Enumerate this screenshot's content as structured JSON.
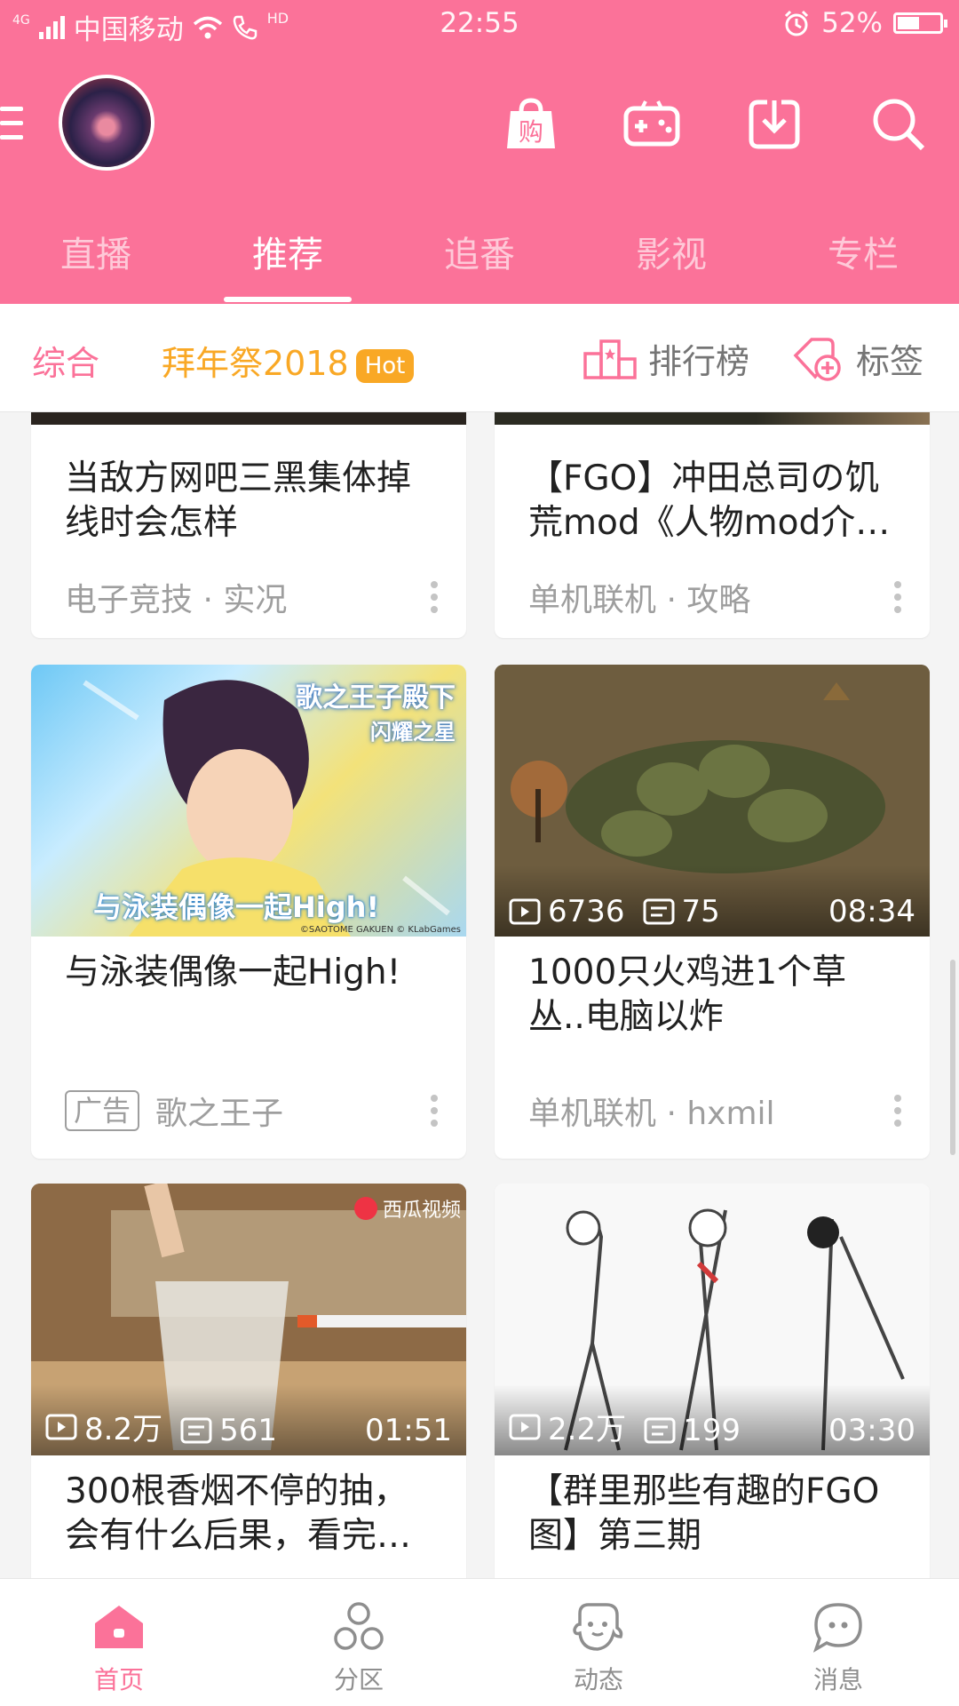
{
  "status": {
    "carrier": "中国移动",
    "network": "4G",
    "hd": "HD",
    "time": "22:55",
    "battery": "52%",
    "battery_level": 0.52
  },
  "header": {
    "tabs": [
      {
        "label": "直播"
      },
      {
        "label": "推荐"
      },
      {
        "label": "追番"
      },
      {
        "label": "影视"
      },
      {
        "label": "专栏"
      }
    ],
    "active_tab": "推荐",
    "icons": [
      "shop-icon",
      "game-icon",
      "download-icon",
      "search-icon"
    ],
    "shop_glyph": "购"
  },
  "subbar": {
    "overview": "综合",
    "event": "拜年祭2018",
    "hot_badge": "Hot",
    "ranking": "排行榜",
    "tags": "标签"
  },
  "cards": [
    {
      "title": "当敌方网吧三黑集体掉线时会怎样",
      "meta": "电子竞技 · 实况"
    },
    {
      "title": "【FGO】冲田总司の饥荒mod《人物mod介…",
      "meta": "单机联机 · 攻略"
    },
    {
      "title": "与泳装偶像一起High!",
      "ad_label": "广告",
      "meta": "歌之王子",
      "banner_text": "歌之王子殿下",
      "banner_sub": "闪耀之星",
      "overlay_text": "与泳装偶像一起High!",
      "copyright": "©SAOTOME GAKUEN © KLabGames"
    },
    {
      "title": "1000只火鸡进1个草丛..电脑以炸",
      "meta": "单机联机 · hxmil",
      "views": "6736",
      "danmaku": "75",
      "duration": "08:34"
    },
    {
      "title": "300根香烟不停的抽，会有什么后果，看完…",
      "views": "8.2万",
      "danmaku": "561",
      "duration": "01:51",
      "watermark": "西瓜视频"
    },
    {
      "title": "【群里那些有趣的FGO图】第三期",
      "views": "2.2万",
      "danmaku": "199",
      "duration": "03:30"
    }
  ],
  "bottom_nav": [
    {
      "label": "首页",
      "icon": "home-icon"
    },
    {
      "label": "分区",
      "icon": "category-icon"
    },
    {
      "label": "动态",
      "icon": "dynamic-icon"
    },
    {
      "label": "消息",
      "icon": "message-icon"
    }
  ],
  "colors": {
    "brand": "#fb7299",
    "event_orange": "#f9a825"
  }
}
